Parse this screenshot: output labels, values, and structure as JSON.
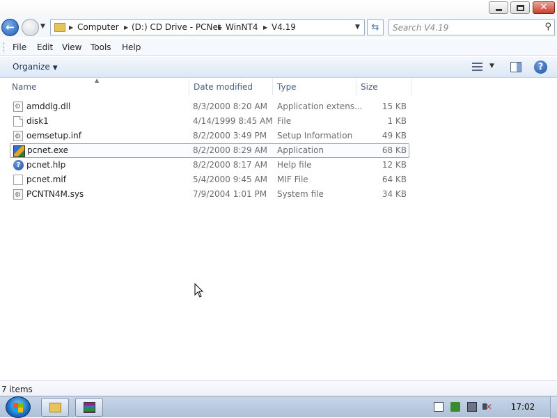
{
  "window": {
    "caption_buttons": {
      "minimize": "minimize",
      "maximize": "maximize",
      "close": "close"
    }
  },
  "address": {
    "icon": "folder-icon",
    "crumbs": [
      "Computer",
      "(D:) CD Drive - PCNet",
      "WinNT4",
      "V4.19"
    ]
  },
  "search": {
    "placeholder": "Search V4.19"
  },
  "menu": [
    "File",
    "Edit",
    "View",
    "Tools",
    "Help"
  ],
  "toolbar": {
    "organize": "Organize"
  },
  "columns": {
    "name": "Name",
    "date": "Date modified",
    "type": "Type",
    "size": "Size"
  },
  "files": [
    {
      "name": "amddlg.dll",
      "date": "8/3/2000 8:20 AM",
      "type": "Application extens...",
      "size": "15 KB",
      "icon": "dll-icon"
    },
    {
      "name": "disk1",
      "date": "4/14/1999 8:45 AM",
      "type": "File",
      "size": "1 KB",
      "icon": "file-icon"
    },
    {
      "name": "oemsetup.inf",
      "date": "8/2/2000 3:49 PM",
      "type": "Setup Information",
      "size": "49 KB",
      "icon": "setup-info-icon"
    },
    {
      "name": "pcnet.exe",
      "date": "8/2/2000 8:29 AM",
      "type": "Application",
      "size": "68 KB",
      "icon": "application-icon",
      "selected": true
    },
    {
      "name": "pcnet.hlp",
      "date": "8/2/2000 8:17 AM",
      "type": "Help file",
      "size": "12 KB",
      "icon": "help-file-icon"
    },
    {
      "name": "pcnet.mif",
      "date": "5/4/2000 9:45 AM",
      "type": "MIF File",
      "size": "64 KB",
      "icon": "file-icon"
    },
    {
      "name": "PCNTN4M.sys",
      "date": "7/9/2004 1:01 PM",
      "type": "System file",
      "size": "34 KB",
      "icon": "system-file-icon"
    }
  ],
  "status": {
    "items": "7 items"
  },
  "taskbar": {
    "clock": "17:02",
    "buttons": [
      "explorer-icon",
      "winrar-icon"
    ],
    "tray": [
      "action-center-icon",
      "security-icon",
      "network-icon",
      "volume-muted-icon"
    ]
  },
  "colors": {
    "accent": "#1f5ab8",
    "selection_border": "#9ea7b3",
    "taskbar": "#aec0d8"
  }
}
